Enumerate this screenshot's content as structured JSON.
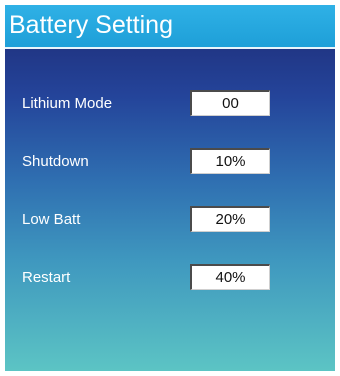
{
  "header": {
    "title": "Battery Setting"
  },
  "settings": [
    {
      "label": "Lithium Mode",
      "value": "00"
    },
    {
      "label": "Shutdown",
      "value": "10%"
    },
    {
      "label": "Low Batt",
      "value": "20%"
    },
    {
      "label": "Restart",
      "value": "40%"
    }
  ],
  "colors": {
    "title_bar": "#1e9fd8",
    "panel_top": "#1e2a73",
    "panel_bottom": "#5cc4c4",
    "text": "#ffffff",
    "field_background": "#ffffff"
  }
}
